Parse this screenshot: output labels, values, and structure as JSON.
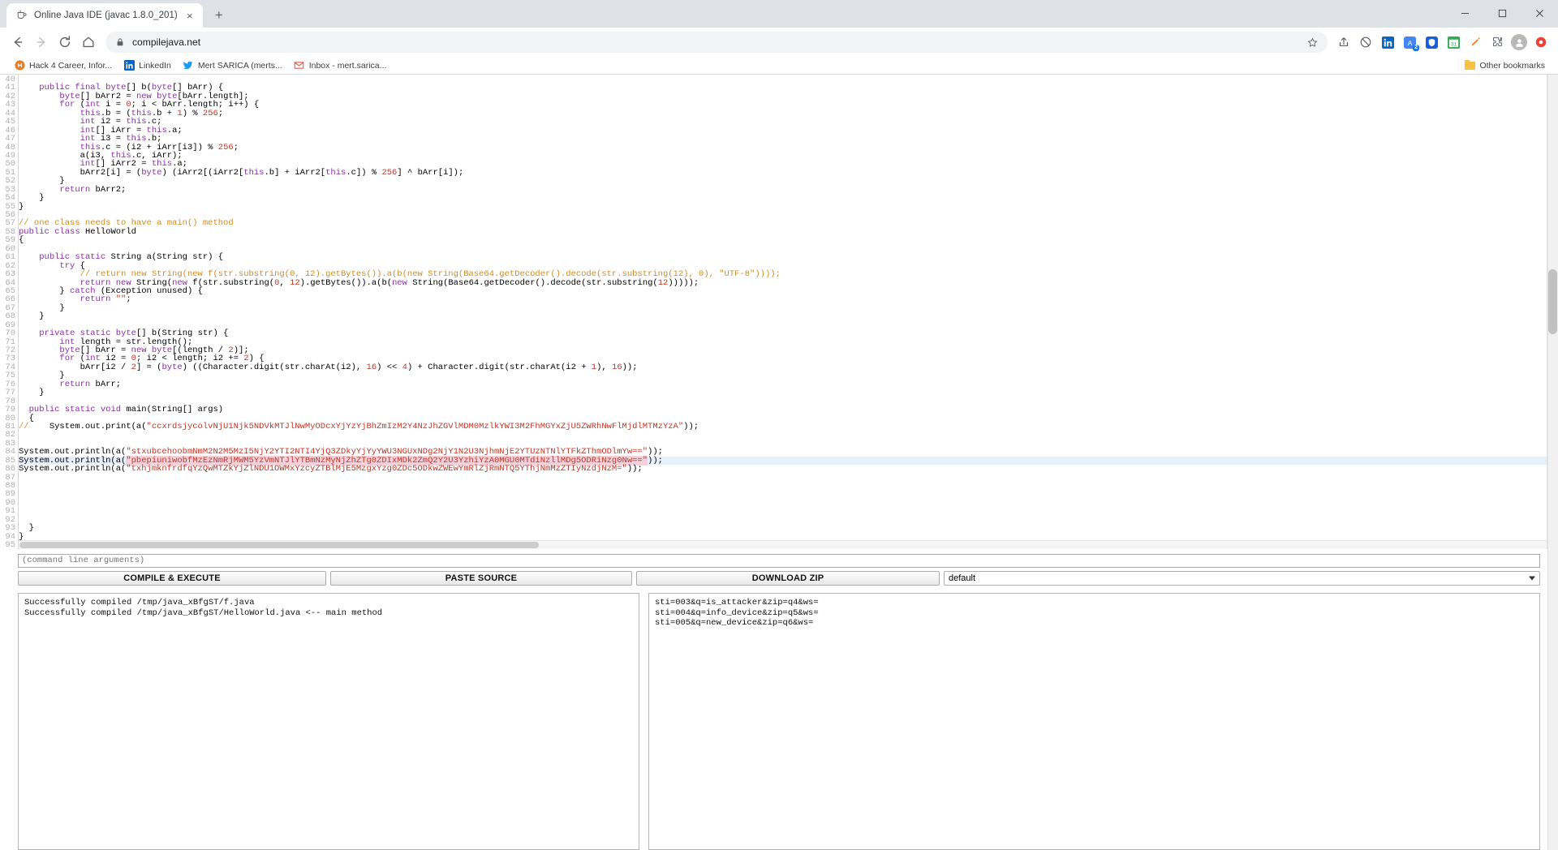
{
  "browser": {
    "tab": {
      "title": "Online Java IDE (javac 1.8.0_201)",
      "favicon": "coffee-cup-icon",
      "close_label": "×"
    },
    "newtab_label": "+",
    "window_controls": {
      "minimize": "─",
      "maximize": "☐",
      "close": "✕"
    },
    "nav": {
      "back": "←",
      "forward": "→",
      "reload": "⟳",
      "home": "⌂"
    },
    "omnibox": {
      "lock_icon": "lock-icon",
      "url": "compilejava.net",
      "star_icon": "star-icon"
    },
    "extensions": [
      {
        "name": "share-icon",
        "glyph": "⇪"
      },
      {
        "name": "block-icon",
        "glyph": "⊘"
      },
      {
        "name": "linkedin-extension-icon",
        "glyph": "in"
      },
      {
        "name": "translate-extension-icon",
        "glyph": "文",
        "badge": "2"
      },
      {
        "name": "bitwarden-extension-icon",
        "glyph": "⛉"
      },
      {
        "name": "calendar-extension-icon",
        "glyph": "31"
      },
      {
        "name": "pen-extension-icon",
        "glyph": "✎"
      },
      {
        "name": "puzzle-extension-icon",
        "glyph": "❖"
      }
    ],
    "profile_icon": "avatar",
    "menu_icon": "record-icon",
    "bookmarks": [
      {
        "label": "Hack 4 Career, Infor...",
        "icon": "hack4career-favicon"
      },
      {
        "label": "LinkedIn",
        "icon": "linkedin-favicon"
      },
      {
        "label": "Mert SARICA (merts...",
        "icon": "twitter-favicon"
      },
      {
        "label": "Inbox - mert.sarica...",
        "icon": "gmail-favicon"
      }
    ],
    "other_bookmarks": {
      "label": "Other bookmarks",
      "icon": "folder-icon"
    }
  },
  "editor": {
    "first_line": 40,
    "lines": [
      {
        "n": 40,
        "tokens": []
      },
      {
        "n": 41,
        "tokens": [
          {
            "t": "    ",
            "c": ""
          },
          {
            "t": "public",
            "c": "kw"
          },
          {
            "t": " ",
            "c": ""
          },
          {
            "t": "final",
            "c": "kw"
          },
          {
            "t": " ",
            "c": ""
          },
          {
            "t": "byte",
            "c": "kw"
          },
          {
            "t": "[] b(",
            "c": ""
          },
          {
            "t": "byte",
            "c": "kw"
          },
          {
            "t": "[] bArr) {",
            "c": ""
          }
        ]
      },
      {
        "n": 42,
        "tokens": [
          {
            "t": "        ",
            "c": ""
          },
          {
            "t": "byte",
            "c": "kw"
          },
          {
            "t": "[] bArr2 = ",
            "c": ""
          },
          {
            "t": "new",
            "c": "kw"
          },
          {
            "t": " ",
            "c": ""
          },
          {
            "t": "byte",
            "c": "kw"
          },
          {
            "t": "[bArr.length];",
            "c": ""
          }
        ]
      },
      {
        "n": 43,
        "tokens": [
          {
            "t": "        ",
            "c": ""
          },
          {
            "t": "for",
            "c": "kw"
          },
          {
            "t": " (",
            "c": ""
          },
          {
            "t": "int",
            "c": "kw"
          },
          {
            "t": " i = ",
            "c": ""
          },
          {
            "t": "0",
            "c": "num"
          },
          {
            "t": "; i < bArr.length; i++) {",
            "c": ""
          }
        ]
      },
      {
        "n": 44,
        "tokens": [
          {
            "t": "            ",
            "c": ""
          },
          {
            "t": "this",
            "c": "kw"
          },
          {
            "t": ".b = (",
            "c": ""
          },
          {
            "t": "this",
            "c": "kw"
          },
          {
            "t": ".b + ",
            "c": ""
          },
          {
            "t": "1",
            "c": "num"
          },
          {
            "t": ") % ",
            "c": ""
          },
          {
            "t": "256",
            "c": "num"
          },
          {
            "t": ";",
            "c": ""
          }
        ]
      },
      {
        "n": 45,
        "tokens": [
          {
            "t": "            ",
            "c": ""
          },
          {
            "t": "int",
            "c": "kw"
          },
          {
            "t": " i2 = ",
            "c": ""
          },
          {
            "t": "this",
            "c": "kw"
          },
          {
            "t": ".c;",
            "c": ""
          }
        ]
      },
      {
        "n": 46,
        "tokens": [
          {
            "t": "            ",
            "c": ""
          },
          {
            "t": "int",
            "c": "kw"
          },
          {
            "t": "[] iArr = ",
            "c": ""
          },
          {
            "t": "this",
            "c": "kw"
          },
          {
            "t": ".a;",
            "c": ""
          }
        ]
      },
      {
        "n": 47,
        "tokens": [
          {
            "t": "            ",
            "c": ""
          },
          {
            "t": "int",
            "c": "kw"
          },
          {
            "t": " i3 = ",
            "c": ""
          },
          {
            "t": "this",
            "c": "kw"
          },
          {
            "t": ".b;",
            "c": ""
          }
        ]
      },
      {
        "n": 48,
        "tokens": [
          {
            "t": "            ",
            "c": ""
          },
          {
            "t": "this",
            "c": "kw"
          },
          {
            "t": ".c = (i2 + iArr[i3]) % ",
            "c": ""
          },
          {
            "t": "256",
            "c": "num"
          },
          {
            "t": ";",
            "c": ""
          }
        ]
      },
      {
        "n": 49,
        "tokens": [
          {
            "t": "            a(i3, ",
            "c": ""
          },
          {
            "t": "this",
            "c": "kw"
          },
          {
            "t": ".c, iArr);",
            "c": ""
          }
        ]
      },
      {
        "n": 50,
        "tokens": [
          {
            "t": "            ",
            "c": ""
          },
          {
            "t": "int",
            "c": "kw"
          },
          {
            "t": "[] iArr2 = ",
            "c": ""
          },
          {
            "t": "this",
            "c": "kw"
          },
          {
            "t": ".a;",
            "c": ""
          }
        ]
      },
      {
        "n": 51,
        "tokens": [
          {
            "t": "            bArr2[i] = (",
            "c": ""
          },
          {
            "t": "byte",
            "c": "kw"
          },
          {
            "t": ") (iArr2[(iArr2[",
            "c": ""
          },
          {
            "t": "this",
            "c": "kw"
          },
          {
            "t": ".b] + iArr2[",
            "c": ""
          },
          {
            "t": "this",
            "c": "kw"
          },
          {
            "t": ".c]) % ",
            "c": ""
          },
          {
            "t": "256",
            "c": "num"
          },
          {
            "t": "] ^ bArr[i]);",
            "c": ""
          }
        ]
      },
      {
        "n": 52,
        "tokens": [
          {
            "t": "        }",
            "c": ""
          }
        ]
      },
      {
        "n": 53,
        "tokens": [
          {
            "t": "        ",
            "c": ""
          },
          {
            "t": "return",
            "c": "kw"
          },
          {
            "t": " bArr2;",
            "c": ""
          }
        ]
      },
      {
        "n": 54,
        "tokens": [
          {
            "t": "    }",
            "c": ""
          }
        ]
      },
      {
        "n": 55,
        "tokens": [
          {
            "t": "}",
            "c": ""
          }
        ]
      },
      {
        "n": 56,
        "tokens": []
      },
      {
        "n": 57,
        "tokens": [
          {
            "t": "// one class needs to have a main() method",
            "c": "com"
          }
        ]
      },
      {
        "n": 58,
        "tokens": [
          {
            "t": "public",
            "c": "kw"
          },
          {
            "t": " ",
            "c": ""
          },
          {
            "t": "class",
            "c": "kw"
          },
          {
            "t": " HelloWorld",
            "c": ""
          }
        ]
      },
      {
        "n": 59,
        "tokens": [
          {
            "t": "{",
            "c": ""
          }
        ]
      },
      {
        "n": 60,
        "tokens": []
      },
      {
        "n": 61,
        "tokens": [
          {
            "t": "    ",
            "c": ""
          },
          {
            "t": "public",
            "c": "kw"
          },
          {
            "t": " ",
            "c": ""
          },
          {
            "t": "static",
            "c": "kw"
          },
          {
            "t": " String a(String str) {",
            "c": ""
          }
        ]
      },
      {
        "n": 62,
        "tokens": [
          {
            "t": "        ",
            "c": ""
          },
          {
            "t": "try",
            "c": "kw"
          },
          {
            "t": " {",
            "c": ""
          }
        ]
      },
      {
        "n": 63,
        "tokens": [
          {
            "t": "            ",
            "c": ""
          },
          {
            "t": "// return new String(new f(str.substring(0, 12).getBytes()).a(b(new String(Base64.getDecoder().decode(str.substring(12), 0), \"UTF-8\"))));",
            "c": "com"
          }
        ]
      },
      {
        "n": 64,
        "tokens": [
          {
            "t": "            ",
            "c": ""
          },
          {
            "t": "return",
            "c": "kw"
          },
          {
            "t": " ",
            "c": ""
          },
          {
            "t": "new",
            "c": "kw"
          },
          {
            "t": " String(",
            "c": ""
          },
          {
            "t": "new",
            "c": "kw"
          },
          {
            "t": " f(str.substring(",
            "c": ""
          },
          {
            "t": "0",
            "c": "num"
          },
          {
            "t": ", ",
            "c": ""
          },
          {
            "t": "12",
            "c": "num"
          },
          {
            "t": ").getBytes()).a(b(",
            "c": ""
          },
          {
            "t": "new",
            "c": "kw"
          },
          {
            "t": " String(Base64.getDecoder().decode(str.substring(",
            "c": ""
          },
          {
            "t": "12",
            "c": "num"
          },
          {
            "t": ")))));",
            "c": ""
          }
        ]
      },
      {
        "n": 65,
        "tokens": [
          {
            "t": "        } ",
            "c": ""
          },
          {
            "t": "catch",
            "c": "kw"
          },
          {
            "t": " (Exception unused) {",
            "c": ""
          }
        ]
      },
      {
        "n": 66,
        "tokens": [
          {
            "t": "            ",
            "c": ""
          },
          {
            "t": "return",
            "c": "kw"
          },
          {
            "t": " ",
            "c": ""
          },
          {
            "t": "\"\"",
            "c": "str"
          },
          {
            "t": ";",
            "c": ""
          }
        ]
      },
      {
        "n": 67,
        "tokens": [
          {
            "t": "        }",
            "c": ""
          }
        ]
      },
      {
        "n": 68,
        "tokens": [
          {
            "t": "    }",
            "c": ""
          }
        ]
      },
      {
        "n": 69,
        "tokens": []
      },
      {
        "n": 70,
        "tokens": [
          {
            "t": "    ",
            "c": ""
          },
          {
            "t": "private",
            "c": "kw"
          },
          {
            "t": " ",
            "c": ""
          },
          {
            "t": "static",
            "c": "kw"
          },
          {
            "t": " ",
            "c": ""
          },
          {
            "t": "byte",
            "c": "kw"
          },
          {
            "t": "[] b(String str) {",
            "c": ""
          }
        ]
      },
      {
        "n": 71,
        "tokens": [
          {
            "t": "        ",
            "c": ""
          },
          {
            "t": "int",
            "c": "kw"
          },
          {
            "t": " length = str.length();",
            "c": ""
          }
        ]
      },
      {
        "n": 72,
        "tokens": [
          {
            "t": "        ",
            "c": ""
          },
          {
            "t": "byte",
            "c": "kw"
          },
          {
            "t": "[] bArr = ",
            "c": ""
          },
          {
            "t": "new",
            "c": "kw"
          },
          {
            "t": " ",
            "c": ""
          },
          {
            "t": "byte",
            "c": "kw"
          },
          {
            "t": "[(length / ",
            "c": ""
          },
          {
            "t": "2",
            "c": "num"
          },
          {
            "t": ")];",
            "c": ""
          }
        ]
      },
      {
        "n": 73,
        "tokens": [
          {
            "t": "        ",
            "c": ""
          },
          {
            "t": "for",
            "c": "kw"
          },
          {
            "t": " (",
            "c": ""
          },
          {
            "t": "int",
            "c": "kw"
          },
          {
            "t": " i2 = ",
            "c": ""
          },
          {
            "t": "0",
            "c": "num"
          },
          {
            "t": "; i2 < length; i2 += ",
            "c": ""
          },
          {
            "t": "2",
            "c": "num"
          },
          {
            "t": ") {",
            "c": ""
          }
        ]
      },
      {
        "n": 74,
        "tokens": [
          {
            "t": "            bArr[i2 / ",
            "c": ""
          },
          {
            "t": "2",
            "c": "num"
          },
          {
            "t": "] = (",
            "c": ""
          },
          {
            "t": "byte",
            "c": "kw"
          },
          {
            "t": ") ((Character.digit(str.charAt(i2), ",
            "c": ""
          },
          {
            "t": "16",
            "c": "num"
          },
          {
            "t": ") << ",
            "c": ""
          },
          {
            "t": "4",
            "c": "num"
          },
          {
            "t": ") + Character.digit(str.charAt(i2 + ",
            "c": ""
          },
          {
            "t": "1",
            "c": "num"
          },
          {
            "t": "), ",
            "c": ""
          },
          {
            "t": "16",
            "c": "num"
          },
          {
            "t": "));",
            "c": ""
          }
        ]
      },
      {
        "n": 75,
        "tokens": [
          {
            "t": "        }",
            "c": ""
          }
        ]
      },
      {
        "n": 76,
        "tokens": [
          {
            "t": "        ",
            "c": ""
          },
          {
            "t": "return",
            "c": "kw"
          },
          {
            "t": " bArr;",
            "c": ""
          }
        ]
      },
      {
        "n": 77,
        "tokens": [
          {
            "t": "    }",
            "c": ""
          }
        ]
      },
      {
        "n": 78,
        "tokens": []
      },
      {
        "n": 79,
        "tokens": [
          {
            "t": "  ",
            "c": ""
          },
          {
            "t": "public",
            "c": "kw"
          },
          {
            "t": " ",
            "c": ""
          },
          {
            "t": "static",
            "c": "kw"
          },
          {
            "t": " ",
            "c": ""
          },
          {
            "t": "void",
            "c": "kw"
          },
          {
            "t": " main(String[] args)",
            "c": ""
          }
        ]
      },
      {
        "n": 80,
        "tokens": [
          {
            "t": "  {",
            "c": ""
          }
        ]
      },
      {
        "n": 81,
        "tokens": [
          {
            "t": "//",
            "c": "com"
          },
          {
            "t": "    System.out.print(a(",
            "c": ""
          },
          {
            "t": "\"ccxrdsjycolvNjU1Njk5NDVkMTJlNwMyODcxYjYzYjBhZmIzM2Y4NzJhZGVlMDM0MzlkYWI3M2FhMGYxZjU5ZWRhNwFlMjdlMTMzYzA\"",
            "c": "str"
          },
          {
            "t": "));",
            "c": ""
          }
        ]
      },
      {
        "n": 82,
        "tokens": []
      },
      {
        "n": 83,
        "tokens": []
      },
      {
        "n": 84,
        "tokens": [
          {
            "t": "System.out.println(a(",
            "c": ""
          },
          {
            "t": "\"stxubcehoobmNmM2N2M5MzI5NjY2YTI2NTI4YjQ3ZDkyYjYyYWU3NGUxNDg2NjY1N2U3NjhmNjE2YTUzNTNlYTFkZThmODlmYw==\"",
            "c": "str"
          },
          {
            "t": "));",
            "c": ""
          }
        ]
      },
      {
        "n": 85,
        "highlight": true,
        "tokens": [
          {
            "t": "System.out.println(a(",
            "c": ""
          },
          {
            "t": "\"pbepiuniwobfMzEzNmRjMWM5YzVmNTJlYTBmNzMyNjZhZTg0ZDIxMDk2ZmQ2Y2U3YzhiYzA0MGU0MTdiNzllMDg5ODRiNzg0Nw==\"",
            "c": "str mark"
          },
          {
            "t": "));",
            "c": ""
          }
        ]
      },
      {
        "n": 86,
        "tokens": [
          {
            "t": "System.out.println(a(",
            "c": ""
          },
          {
            "t": "\"txhjmknfrdfqYzQwMTZkYjZlNDU1OWMxYzcyZTBlMjE5MzgxYzg0ZDc5ODkwZWEwYmRlZjRmNTQ5YThjNmMzZTIyNzdjNzM=\"",
            "c": "str"
          },
          {
            "t": "));",
            "c": ""
          }
        ]
      },
      {
        "n": 87,
        "tokens": []
      },
      {
        "n": 88,
        "tokens": []
      },
      {
        "n": 89,
        "tokens": []
      },
      {
        "n": 90,
        "tokens": []
      },
      {
        "n": 91,
        "tokens": []
      },
      {
        "n": 92,
        "tokens": []
      },
      {
        "n": 93,
        "tokens": [
          {
            "t": "  }",
            "c": ""
          }
        ]
      },
      {
        "n": 94,
        "tokens": [
          {
            "t": "}",
            "c": ""
          }
        ]
      },
      {
        "n": 95,
        "tokens": []
      }
    ]
  },
  "controls": {
    "args_placeholder": "(command line arguments)",
    "args_value": "",
    "buttons": {
      "compile": "COMPILE & EXECUTE",
      "paste": "PASTE SOURCE",
      "download": "DOWNLOAD ZIP"
    },
    "select": {
      "value": "default"
    }
  },
  "output": {
    "console": "Successfully compiled /tmp/java_xBfgST/f.java\nSuccessfully compiled /tmp/java_xBfgST/HelloWorld.java <-- main method",
    "result": "sti=003&q=is_attacker&zip=q4&ws=\nsti=004&q=info_device&zip=q5&ws=\nsti=005&q=new_device&zip=q6&ws="
  }
}
